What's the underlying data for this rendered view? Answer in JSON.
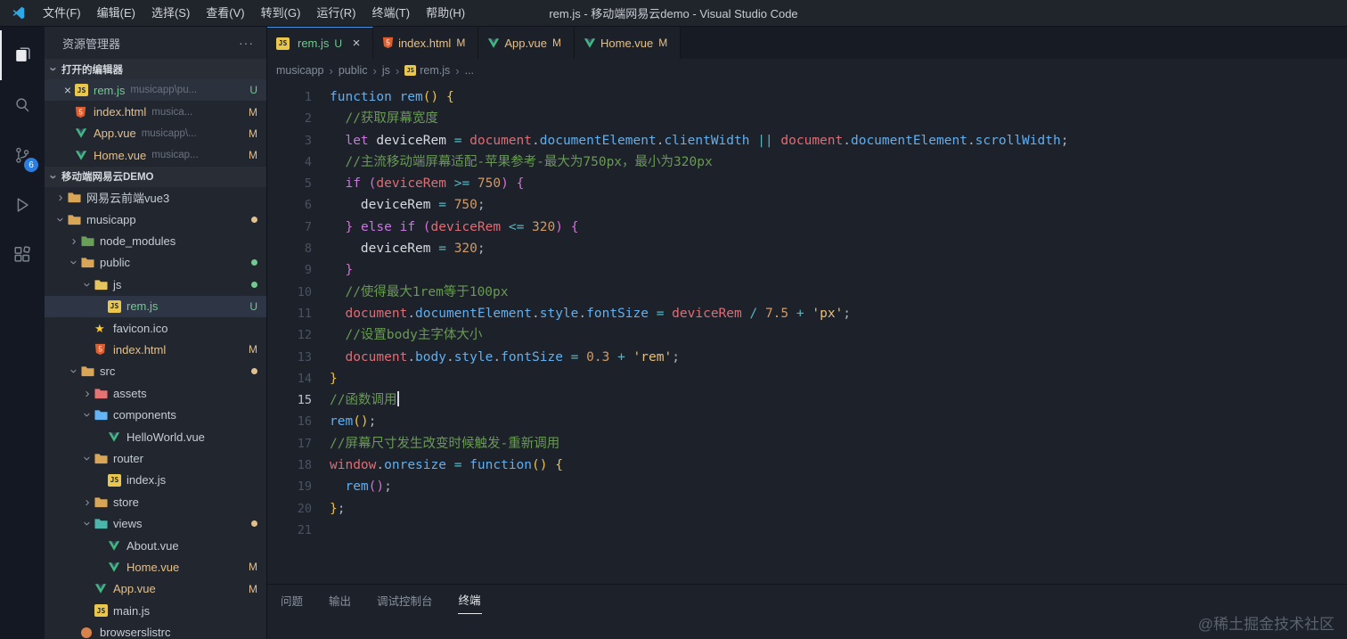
{
  "title_bar": {
    "menus": [
      "文件(F)",
      "编辑(E)",
      "选择(S)",
      "查看(V)",
      "转到(G)",
      "运行(R)",
      "终端(T)",
      "帮助(H)"
    ],
    "title": "rem.js - 移动端网易云demo - Visual Studio Code"
  },
  "activity_bar": {
    "items": [
      {
        "name": "explorer",
        "active": true
      },
      {
        "name": "search",
        "active": false
      },
      {
        "name": "source-control",
        "active": false,
        "badge": "6"
      },
      {
        "name": "run-debug",
        "active": false
      },
      {
        "name": "extensions",
        "active": false
      }
    ]
  },
  "sidebar": {
    "title": "资源管理器",
    "actions": "···",
    "open_editors": {
      "label": "打开的编辑器",
      "items": [
        {
          "icon": "js",
          "label": "rem.js",
          "detail": "musicapp\\pu...",
          "git": "U",
          "active": true
        },
        {
          "icon": "html",
          "label": "index.html",
          "detail": "musica...",
          "git": "M",
          "active": false
        },
        {
          "icon": "vue",
          "label": "App.vue",
          "detail": "musicapp\\...",
          "git": "M",
          "active": false
        },
        {
          "icon": "vue",
          "label": "Home.vue",
          "detail": "musicap...",
          "git": "M",
          "active": false
        }
      ]
    },
    "workspace": {
      "label": "移动端网易云DEMO",
      "tree": [
        {
          "depth": 0,
          "type": "folder",
          "expanded": false,
          "label": "网易云前端vue3",
          "color": "#d8a656"
        },
        {
          "depth": 0,
          "type": "folder",
          "expanded": true,
          "label": "musicapp",
          "color": "#d8a656",
          "dot": "#e2c08d"
        },
        {
          "depth": 1,
          "type": "folder",
          "expanded": false,
          "label": "node_modules",
          "color": "#6a9f58"
        },
        {
          "depth": 1,
          "type": "folder",
          "expanded": true,
          "label": "public",
          "color": "#d8a656",
          "dot": "#73c991"
        },
        {
          "depth": 2,
          "type": "folder",
          "expanded": true,
          "label": "js",
          "color": "#e6c45e",
          "dot": "#73c991"
        },
        {
          "depth": 3,
          "type": "file",
          "icon": "js",
          "label": "rem.js",
          "git": "U",
          "selected": true
        },
        {
          "depth": 2,
          "type": "file",
          "icon": "favicon",
          "label": "favicon.ico"
        },
        {
          "depth": 2,
          "type": "file",
          "icon": "html",
          "label": "index.html",
          "git": "M"
        },
        {
          "depth": 1,
          "type": "folder",
          "expanded": true,
          "label": "src",
          "color": "#d8a656",
          "dot": "#e2c08d"
        },
        {
          "depth": 2,
          "type": "folder",
          "expanded": false,
          "label": "assets",
          "color": "#e57373"
        },
        {
          "depth": 2,
          "type": "folder",
          "expanded": true,
          "label": "components",
          "color": "#64b5f6"
        },
        {
          "depth": 3,
          "type": "file",
          "icon": "vue",
          "label": "HelloWorld.vue"
        },
        {
          "depth": 2,
          "type": "folder",
          "expanded": true,
          "label": "router",
          "color": "#d8a656"
        },
        {
          "depth": 3,
          "type": "file",
          "icon": "js",
          "label": "index.js"
        },
        {
          "depth": 2,
          "type": "folder",
          "expanded": false,
          "label": "store",
          "color": "#d8a656"
        },
        {
          "depth": 2,
          "type": "folder",
          "expanded": true,
          "label": "views",
          "color": "#4db6ac",
          "dot": "#e2c08d"
        },
        {
          "depth": 3,
          "type": "file",
          "icon": "vue",
          "label": "About.vue"
        },
        {
          "depth": 3,
          "type": "file",
          "icon": "vue",
          "label": "Home.vue",
          "git": "M"
        },
        {
          "depth": 2,
          "type": "file",
          "icon": "vue",
          "label": "App.vue",
          "git": "M"
        },
        {
          "depth": 2,
          "type": "file",
          "icon": "js",
          "label": "main.js"
        },
        {
          "depth": 1,
          "type": "file",
          "icon": "browserslist",
          "label": "browserslistrc"
        }
      ]
    }
  },
  "editor": {
    "tabs": [
      {
        "icon": "js",
        "label": "rem.js",
        "git": "U",
        "active": true,
        "close": "×"
      },
      {
        "icon": "html",
        "label": "index.html",
        "git": "M",
        "active": false
      },
      {
        "icon": "vue",
        "label": "App.vue",
        "git": "M",
        "active": false
      },
      {
        "icon": "vue",
        "label": "Home.vue",
        "git": "M",
        "active": false
      }
    ],
    "breadcrumbs": [
      {
        "label": "musicapp"
      },
      {
        "label": "public"
      },
      {
        "label": "js"
      },
      {
        "label": "rem.js",
        "icon": "js"
      },
      {
        "label": "..."
      }
    ],
    "code": {
      "active_line": 15,
      "cursor_line": 15,
      "lines": [
        [
          [
            "function ",
            "kwfn"
          ],
          [
            "rem",
            "fn"
          ],
          [
            "()",
            "b1"
          ],
          [
            " ",
            null
          ],
          [
            "{",
            "b1"
          ]
        ],
        [
          [
            "  ",
            null
          ],
          [
            "//获取屏幕宽度",
            "cm"
          ]
        ],
        [
          [
            "  ",
            null
          ],
          [
            "let ",
            "kw"
          ],
          [
            "deviceRem",
            "v"
          ],
          [
            " ",
            null
          ],
          [
            "=",
            "op"
          ],
          [
            " ",
            null
          ],
          [
            "document",
            "obj"
          ],
          [
            ".",
            "pn"
          ],
          [
            "documentElement",
            "prop"
          ],
          [
            ".",
            "pn"
          ],
          [
            "clientWidth",
            "prop"
          ],
          [
            " ",
            null
          ],
          [
            "||",
            "op"
          ],
          [
            " ",
            null
          ],
          [
            "document",
            "obj"
          ],
          [
            ".",
            "pn"
          ],
          [
            "documentElement",
            "prop"
          ],
          [
            ".",
            "pn"
          ],
          [
            "scrollWidth",
            "prop"
          ],
          [
            ";",
            "pn"
          ]
        ],
        [
          [
            "  ",
            null
          ],
          [
            "//主流移动端屏幕适配-苹果参考-最大为750px，最小为320px",
            "cm"
          ]
        ],
        [
          [
            "  ",
            null
          ],
          [
            "if",
            "kw"
          ],
          [
            " ",
            null
          ],
          [
            "(",
            "b2"
          ],
          [
            "deviceRem",
            "vr"
          ],
          [
            " ",
            null
          ],
          [
            ">=",
            "op"
          ],
          [
            " ",
            null
          ],
          [
            "750",
            "num"
          ],
          [
            ")",
            "b2"
          ],
          [
            " ",
            null
          ],
          [
            "{",
            "b2"
          ]
        ],
        [
          [
            "    ",
            null
          ],
          [
            "deviceRem",
            "v"
          ],
          [
            " ",
            null
          ],
          [
            "=",
            "op"
          ],
          [
            " ",
            null
          ],
          [
            "750",
            "num"
          ],
          [
            ";",
            "pn"
          ]
        ],
        [
          [
            "  ",
            null
          ],
          [
            "}",
            "b2"
          ],
          [
            " ",
            null
          ],
          [
            "else",
            "kw"
          ],
          [
            " ",
            null
          ],
          [
            "if",
            "kw"
          ],
          [
            " ",
            null
          ],
          [
            "(",
            "b2"
          ],
          [
            "deviceRem",
            "vr"
          ],
          [
            " ",
            null
          ],
          [
            "<=",
            "op"
          ],
          [
            " ",
            null
          ],
          [
            "320",
            "num"
          ],
          [
            ")",
            "b2"
          ],
          [
            " ",
            null
          ],
          [
            "{",
            "b2"
          ]
        ],
        [
          [
            "    ",
            null
          ],
          [
            "deviceRem",
            "v"
          ],
          [
            " ",
            null
          ],
          [
            "=",
            "op"
          ],
          [
            " ",
            null
          ],
          [
            "320",
            "num"
          ],
          [
            ";",
            "pn"
          ]
        ],
        [
          [
            "  ",
            null
          ],
          [
            "}",
            "b2"
          ]
        ],
        [
          [
            "  ",
            null
          ],
          [
            "//使得最大1rem等于100px",
            "cm"
          ]
        ],
        [
          [
            "  ",
            null
          ],
          [
            "document",
            "obj"
          ],
          [
            ".",
            "pn"
          ],
          [
            "documentElement",
            "prop"
          ],
          [
            ".",
            "pn"
          ],
          [
            "style",
            "prop"
          ],
          [
            ".",
            "pn"
          ],
          [
            "fontSize",
            "prop"
          ],
          [
            " ",
            null
          ],
          [
            "=",
            "op"
          ],
          [
            " ",
            null
          ],
          [
            "deviceRem",
            "vr"
          ],
          [
            " ",
            null
          ],
          [
            "/",
            "op"
          ],
          [
            " ",
            null
          ],
          [
            "7.5",
            "num"
          ],
          [
            " ",
            null
          ],
          [
            "+",
            "op"
          ],
          [
            " ",
            null
          ],
          [
            "'px'",
            "str"
          ],
          [
            ";",
            "pn"
          ]
        ],
        [
          [
            "  ",
            null
          ],
          [
            "//设置body主字体大小",
            "cm"
          ]
        ],
        [
          [
            "  ",
            null
          ],
          [
            "document",
            "obj"
          ],
          [
            ".",
            "pn"
          ],
          [
            "body",
            "prop"
          ],
          [
            ".",
            "pn"
          ],
          [
            "style",
            "prop"
          ],
          [
            ".",
            "pn"
          ],
          [
            "fontSize",
            "prop"
          ],
          [
            " ",
            null
          ],
          [
            "=",
            "op"
          ],
          [
            " ",
            null
          ],
          [
            "0.3",
            "num"
          ],
          [
            " ",
            null
          ],
          [
            "+",
            "op"
          ],
          [
            " ",
            null
          ],
          [
            "'rem'",
            "str"
          ],
          [
            ";",
            "pn"
          ]
        ],
        [
          [
            "}",
            "b1"
          ]
        ],
        [
          [
            "//函数调用",
            "cm"
          ]
        ],
        [
          [
            "rem",
            "fn"
          ],
          [
            "()",
            "b1"
          ],
          [
            ";",
            "pn"
          ]
        ],
        [
          [
            "//屏幕尺寸发生改变时候触发-重新调用",
            "cm"
          ]
        ],
        [
          [
            "window",
            "obj"
          ],
          [
            ".",
            "pn"
          ],
          [
            "onresize",
            "prop"
          ],
          [
            " ",
            null
          ],
          [
            "=",
            "op"
          ],
          [
            " ",
            null
          ],
          [
            "function",
            "kwfn"
          ],
          [
            "()",
            "b1"
          ],
          [
            " ",
            null
          ],
          [
            "{",
            "b1"
          ]
        ],
        [
          [
            "  ",
            null
          ],
          [
            "rem",
            "fn"
          ],
          [
            "()",
            "b2"
          ],
          [
            ";",
            "pn"
          ]
        ],
        [
          [
            "}",
            "b1"
          ],
          [
            ";",
            "pn"
          ]
        ],
        []
      ]
    }
  },
  "panel": {
    "tabs": [
      {
        "label": "问题",
        "active": false
      },
      {
        "label": "输出",
        "active": false
      },
      {
        "label": "调试控制台",
        "active": false
      },
      {
        "label": "终端",
        "active": true
      }
    ],
    "watermark": "@稀土掘金技术社区"
  }
}
